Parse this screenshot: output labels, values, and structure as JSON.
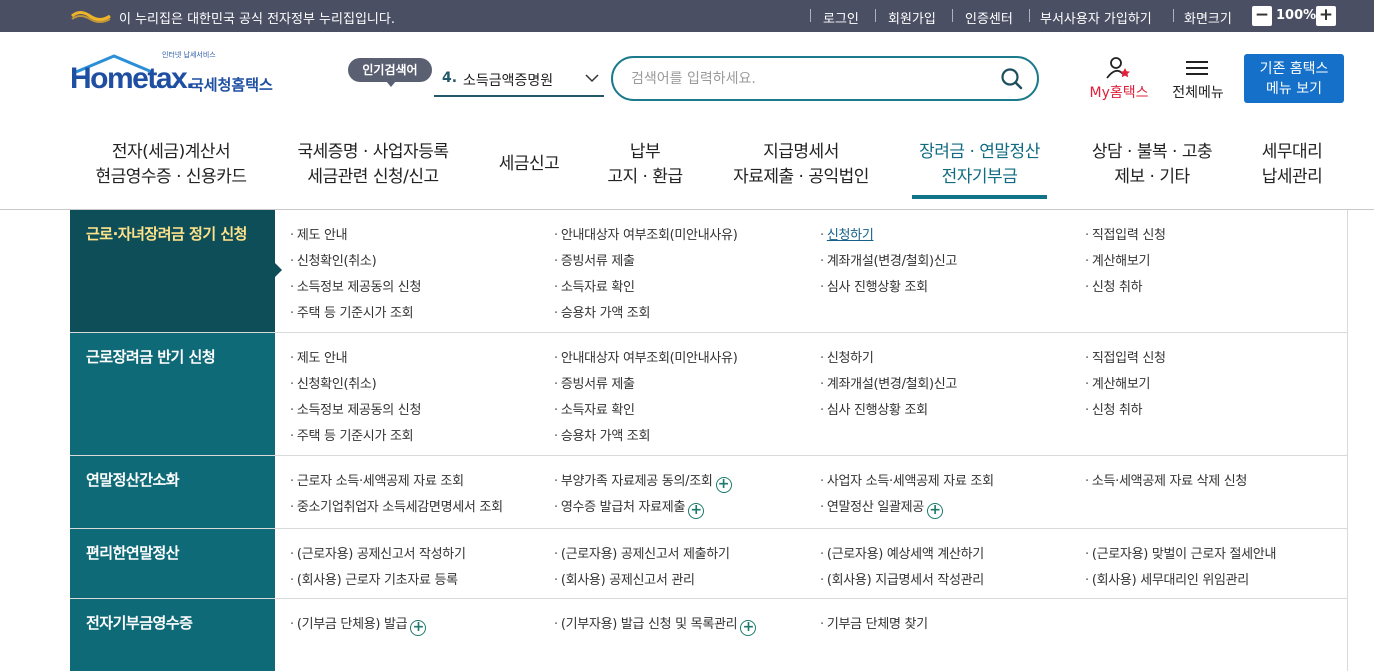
{
  "topbar": {
    "gov_notice": "이 누리집은 대한민국 공식 전자정부 누리집입니다.",
    "links": [
      "로그인",
      "회원가입",
      "인증센터",
      "부서사용자 가입하기",
      "화면크기"
    ],
    "zoom_minus": "−",
    "zoom_value": "100%",
    "zoom_plus": "+"
  },
  "header": {
    "logo_tagline": "인터넷 납세서비스",
    "logo_text": "Hometax.",
    "logo_korean": "국세청홈택스",
    "popular_badge": "인기검색어",
    "popular_rank": "4.",
    "popular_term": "소득금액증명원",
    "search_placeholder": "검색어를 입력하세요.",
    "my_hometax": "My홈택스",
    "all_menu": "전체메뉴",
    "old_hometax_line1": "기존 홈택스",
    "old_hometax_line2": "메뉴 보기"
  },
  "gnb": [
    {
      "line1": "전자(세금)계산서",
      "line2": "현금영수증 · 신용카드"
    },
    {
      "line1": "국세증명 · 사업자등록",
      "line2": "세금관련 신청/신고"
    },
    {
      "line1": "세금신고",
      "line2": ""
    },
    {
      "line1": "납부",
      "line2": "고지 · 환급"
    },
    {
      "line1": "지급명세서",
      "line2": "자료제출 · 공익법인"
    },
    {
      "line1": "장려금 · 연말정산",
      "line2": "전자기부금"
    },
    {
      "line1": "상담 · 불복 · 고충",
      "line2": "제보 · 기타"
    },
    {
      "line1": "세무대리",
      "line2": "납세관리"
    }
  ],
  "sections": [
    {
      "title": "근로·자녀장려금 정기 신청",
      "links": [
        "제도 안내",
        "안내대상자 여부조회(미안내사유)",
        "신청하기",
        "직접입력 신청",
        "신청확인(취소)",
        "증빙서류 제출",
        "계좌개설(변경/철회)신고",
        "계산해보기",
        "소득정보 제공동의 신청",
        "소득자료 확인",
        "심사 진행상황 조회",
        "신청 취하",
        "주택 등 기준시가 조회",
        "승용차 가액 조회"
      ]
    },
    {
      "title": "근로장려금 반기 신청",
      "links": [
        "제도 안내",
        "안내대상자 여부조회(미안내사유)",
        "신청하기",
        "직접입력 신청",
        "신청확인(취소)",
        "증빙서류 제출",
        "계좌개설(변경/철회)신고",
        "계산해보기",
        "소득정보 제공동의 신청",
        "소득자료 확인",
        "심사 진행상황 조회",
        "신청 취하",
        "주택 등 기준시가 조회",
        "승용차 가액 조회"
      ]
    },
    {
      "title": "연말정산간소화",
      "links": [
        "근로자 소득·세액공제 자료 조회",
        "부양가족 자료제공 동의/조회",
        "사업자 소득·세액공제 자료 조회",
        "소득·세액공제 자료 삭제 신청",
        "중소기업취업자 소득세감면명세서 조회",
        "영수증 발급처 자료제출",
        "연말정산 일괄제공"
      ]
    },
    {
      "title": "편리한연말정산",
      "links": [
        "(근로자용) 공제신고서 작성하기",
        "(근로자용) 공제신고서 제출하기",
        "(근로자용) 예상세액 계산하기",
        "(근로자용) 맞벌이 근로자 절세안내",
        "(회사용) 근로자 기초자료 등록",
        "(회사용) 공제신고서 관리",
        "(회사용) 지급명세서 작성관리",
        "(회사용) 세무대리인 위임관리"
      ]
    },
    {
      "title": "전자기부금영수증",
      "links": [
        "(기부금 단체용) 발급",
        "(기부자용) 발급 신청 및 목록관리",
        "기부금 단체명 찾기"
      ]
    }
  ],
  "plus_symbol": "+"
}
